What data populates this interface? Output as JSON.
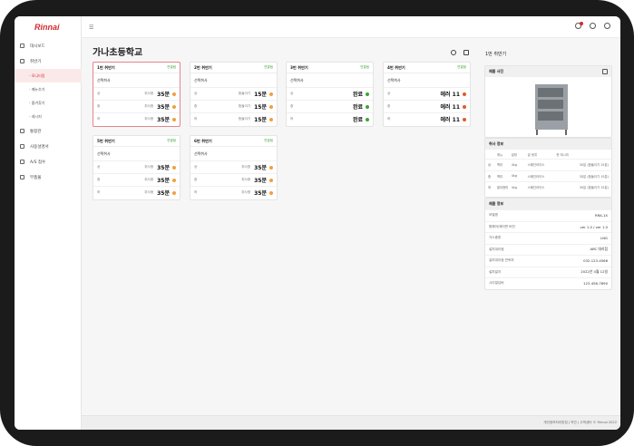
{
  "app": {
    "logo": "Rinnai"
  },
  "sidebar": {
    "items": [
      {
        "label": "대시보드",
        "icon": "home-icon"
      },
      {
        "label": "취반기",
        "icon": "cooker-icon",
        "subs": [
          "모니터링",
          "메뉴추가",
          "즐겨찾기",
          "레시피"
        ],
        "active_sub": 0
      },
      {
        "label": "통합관",
        "icon": "circle-icon"
      },
      {
        "label": "사용설명서",
        "icon": "book-icon"
      },
      {
        "label": "A/S 접수",
        "icon": "tool-icon"
      },
      {
        "label": "부품몰",
        "icon": "cart-icon"
      }
    ]
  },
  "page": {
    "title": "가나초등학교"
  },
  "cards": [
    {
      "title": "1번 취반기",
      "status": "연결됨",
      "menu": "선택취사",
      "rows": [
        [
          "상",
          "취사중",
          "35분",
          "#f0a040"
        ],
        [
          "중",
          "취사중",
          "35분",
          "#f0a040"
        ],
        [
          "하",
          "취사중",
          "35분",
          "#f0a040"
        ]
      ]
    },
    {
      "title": "2번 취반기",
      "status": "연결됨",
      "menu": "선택취사",
      "rows": [
        [
          "상",
          "뜸들이기",
          "15분",
          "#f0a040"
        ],
        [
          "중",
          "뜸들이기",
          "15분",
          "#f0a040"
        ],
        [
          "하",
          "뜸들이기",
          "15분",
          "#f0a040"
        ]
      ]
    },
    {
      "title": "3번 취반기",
      "status": "연결됨",
      "menu": "선택취사",
      "rows": [
        [
          "상",
          "",
          "완료",
          "#3aa53a"
        ],
        [
          "중",
          "",
          "완료",
          "#3aa53a"
        ],
        [
          "하",
          "",
          "완료",
          "#3aa53a"
        ]
      ]
    },
    {
      "title": "4번 취반기",
      "status": "연결됨",
      "menu": "선택취사",
      "rows": [
        [
          "상",
          "",
          "에러 11",
          "#e05a2a"
        ],
        [
          "중",
          "",
          "에러 11",
          "#e05a2a"
        ],
        [
          "하",
          "",
          "에러 11",
          "#e05a2a"
        ]
      ]
    },
    {
      "title": "5번 취반기",
      "status": "연결됨",
      "menu": "선택취사",
      "rows": [
        [
          "상",
          "취사중",
          "35분",
          "#f0a040"
        ],
        [
          "중",
          "취사중",
          "35분",
          "#f0a040"
        ],
        [
          "하",
          "취사중",
          "35분",
          "#f0a040"
        ]
      ]
    },
    {
      "title": "6번 취반기",
      "status": "연결됨",
      "menu": "선택취사",
      "rows": [
        [
          "상",
          "취사중",
          "35분",
          "#f0a040"
        ],
        [
          "중",
          "취사중",
          "35분",
          "#f0a040"
        ],
        [
          "하",
          "취사중",
          "35분",
          "#f0a040"
        ]
      ]
    }
  ],
  "panel": {
    "title": "1번 취반기",
    "photo_label": "제품 사진",
    "cook_label": "취사 정보",
    "hist_headers": [
      "",
      "메뉴",
      "쌀량",
      "쌀 종류",
      "총 레시피"
    ],
    "hist_rows": [
      [
        "상",
        "백미",
        "4kg",
        "스페인라이스",
        "35분 (뜸들이기 15분)"
      ],
      [
        "중",
        "백미",
        "4kg",
        "스페인라이스",
        "35분 (뜸들이기 15분)"
      ],
      [
        "하",
        "발아현미",
        "4kg",
        "스페인라이스",
        "35분 (뜸들이기 15분)"
      ]
    ],
    "info_label": "제품 정보",
    "info_rows": [
      [
        "모델명",
        "RRA-1X"
      ],
      [
        "펌웨어/제어판 버전",
        "ver 1.0 / ver 1.0"
      ],
      [
        "가스종류",
        "LNG"
      ],
      [
        "설치대리점",
        "ABC 대리점"
      ],
      [
        "설치대리점 연락처",
        "032-123-4566"
      ],
      [
        "설치일자",
        "2022년 4월 12일"
      ],
      [
        "시리얼넘버",
        "123-456-7890"
      ]
    ]
  },
  "footer": {
    "text": "개인정보처리방침  |  약관  |  고객센터     © Rinnai 2022"
  },
  "colors": {
    "brand": "#d3282e",
    "connected": "#3aa53a"
  }
}
